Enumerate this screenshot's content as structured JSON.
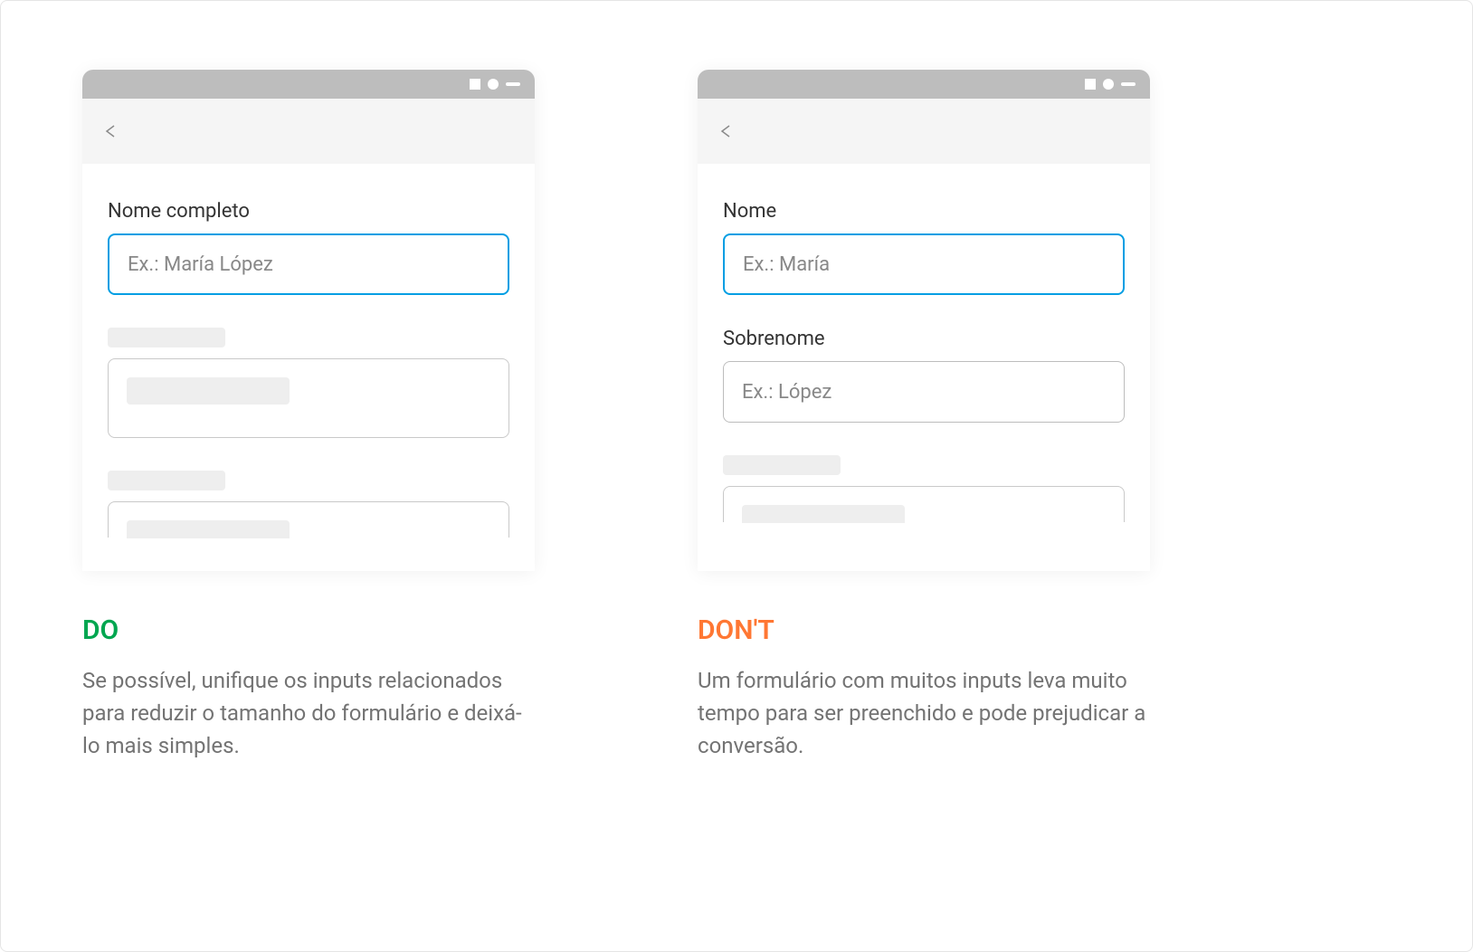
{
  "do_example": {
    "field1_label": "Nome completo",
    "field1_placeholder": "Ex.: María López"
  },
  "dont_example": {
    "field1_label": "Nome",
    "field1_placeholder": "Ex.: María",
    "field2_label": "Sobrenome",
    "field2_placeholder": "Ex.: López"
  },
  "captions": {
    "do_heading": "DO",
    "do_text": "Se possível, unifique os inputs relacionados para reduzir o tamanho do formulário e deixá-lo mais simples.",
    "dont_heading": "DON'T",
    "dont_text": "Um formulário com muitos inputs leva muito tempo para ser preenchido e pode prejudicar a conversão."
  }
}
